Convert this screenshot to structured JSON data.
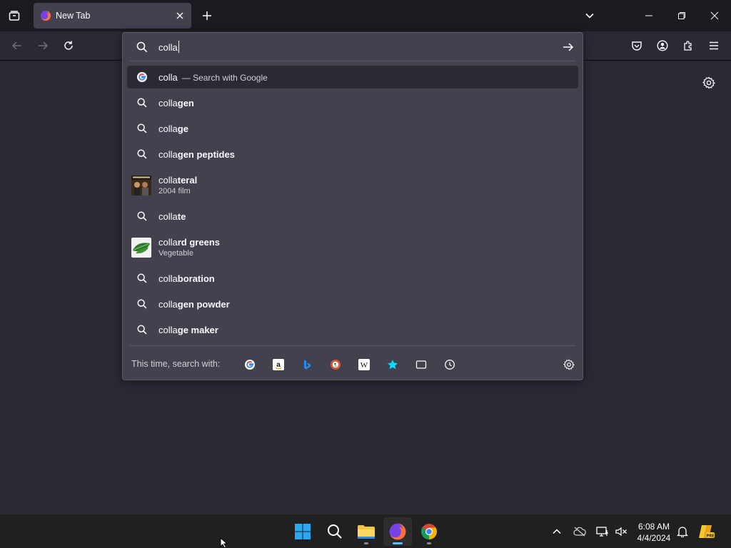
{
  "browser": {
    "tab": {
      "title": "New Tab"
    }
  },
  "urlbar": {
    "input_value": "colla",
    "results": [
      {
        "type": "action",
        "icon": "google-icon",
        "prefix": "colla",
        "suffix": "",
        "action": "— Search with Google"
      },
      {
        "type": "suggestion",
        "icon": "search-icon",
        "prefix": "colla",
        "suffix": "gen"
      },
      {
        "type": "suggestion",
        "icon": "search-icon",
        "prefix": "colla",
        "suffix": "ge"
      },
      {
        "type": "suggestion",
        "icon": "search-icon",
        "prefix": "colla",
        "suffix": "gen peptides"
      },
      {
        "type": "rich",
        "thumb": "collateral-poster-thumbnail",
        "prefix": "colla",
        "suffix": "teral",
        "sub": "2004 film"
      },
      {
        "type": "suggestion",
        "icon": "search-icon",
        "prefix": "colla",
        "suffix": "te"
      },
      {
        "type": "rich",
        "thumb": "collard-greens-thumbnail",
        "prefix": "colla",
        "suffix": "rd greens",
        "sub": "Vegetable"
      },
      {
        "type": "suggestion",
        "icon": "search-icon",
        "prefix": "colla",
        "suffix": "boration"
      },
      {
        "type": "suggestion",
        "icon": "search-icon",
        "prefix": "colla",
        "suffix": "gen powder"
      },
      {
        "type": "suggestion",
        "icon": "search-icon",
        "prefix": "colla",
        "suffix": "ge maker"
      }
    ],
    "footer": {
      "label": "This time, search with:",
      "engines": [
        "google-icon",
        "amazon-icon",
        "bing-icon",
        "duckduckgo-icon",
        "wikipedia-icon",
        "bookmarks-star-icon",
        "tabs-icon",
        "history-clock-icon"
      ]
    }
  },
  "taskbar": {
    "apps": [
      "windows-start-icon",
      "search-icon",
      "file-explorer-icon",
      "firefox-icon",
      "chrome-icon"
    ],
    "clock": {
      "time": "6:08 AM",
      "date": "4/4/2024"
    }
  },
  "colors": {
    "accent_taskbar": "#4cc2ff",
    "panel": "#42414d",
    "background": "#2b2a33"
  }
}
